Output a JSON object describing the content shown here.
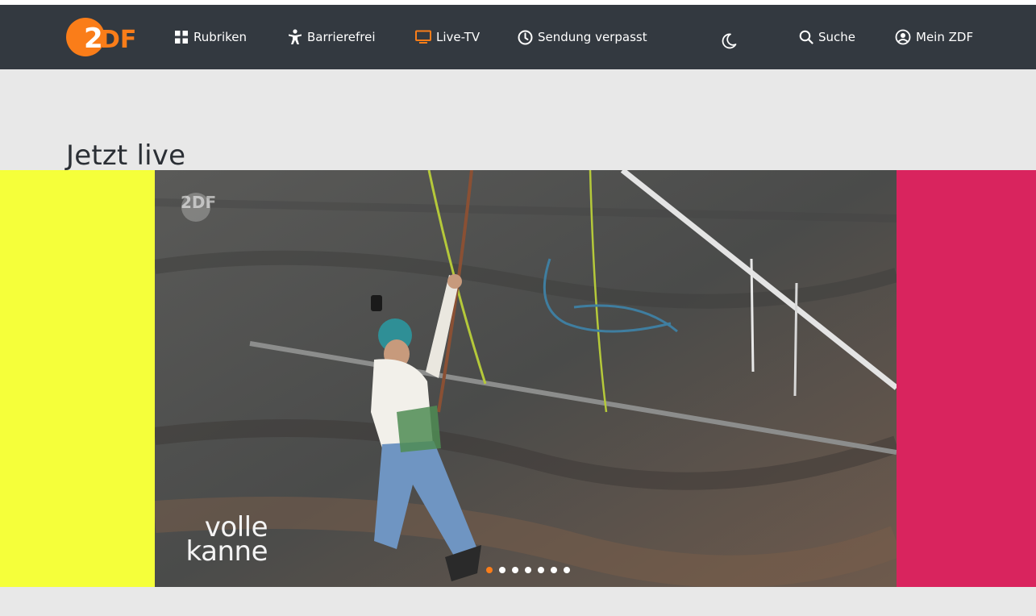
{
  "brand": {
    "logo_text": "2DF",
    "accent": "#fa7d19",
    "nav_bg": "#333940"
  },
  "nav": {
    "items": [
      {
        "label": "Rubriken",
        "icon": "grid-icon"
      },
      {
        "label": "Barrierefrei",
        "icon": "accessibility-icon"
      },
      {
        "label": "Live-TV",
        "icon": "tv-icon",
        "active": true
      },
      {
        "label": "Sendung verpasst",
        "icon": "clock-icon"
      }
    ],
    "theme_icon": "moon-icon",
    "search_label": "Suche",
    "account_label": "Mein ZDF"
  },
  "main": {
    "section_title": "Jetzt live",
    "carousel": {
      "left_color": "#f5ff3a",
      "right_color": "#d9245e",
      "watermark": "2DF",
      "show_logo_line1": "volle",
      "show_logo_line2": "kanne",
      "slide_count": 7,
      "active_slide": 1
    }
  }
}
